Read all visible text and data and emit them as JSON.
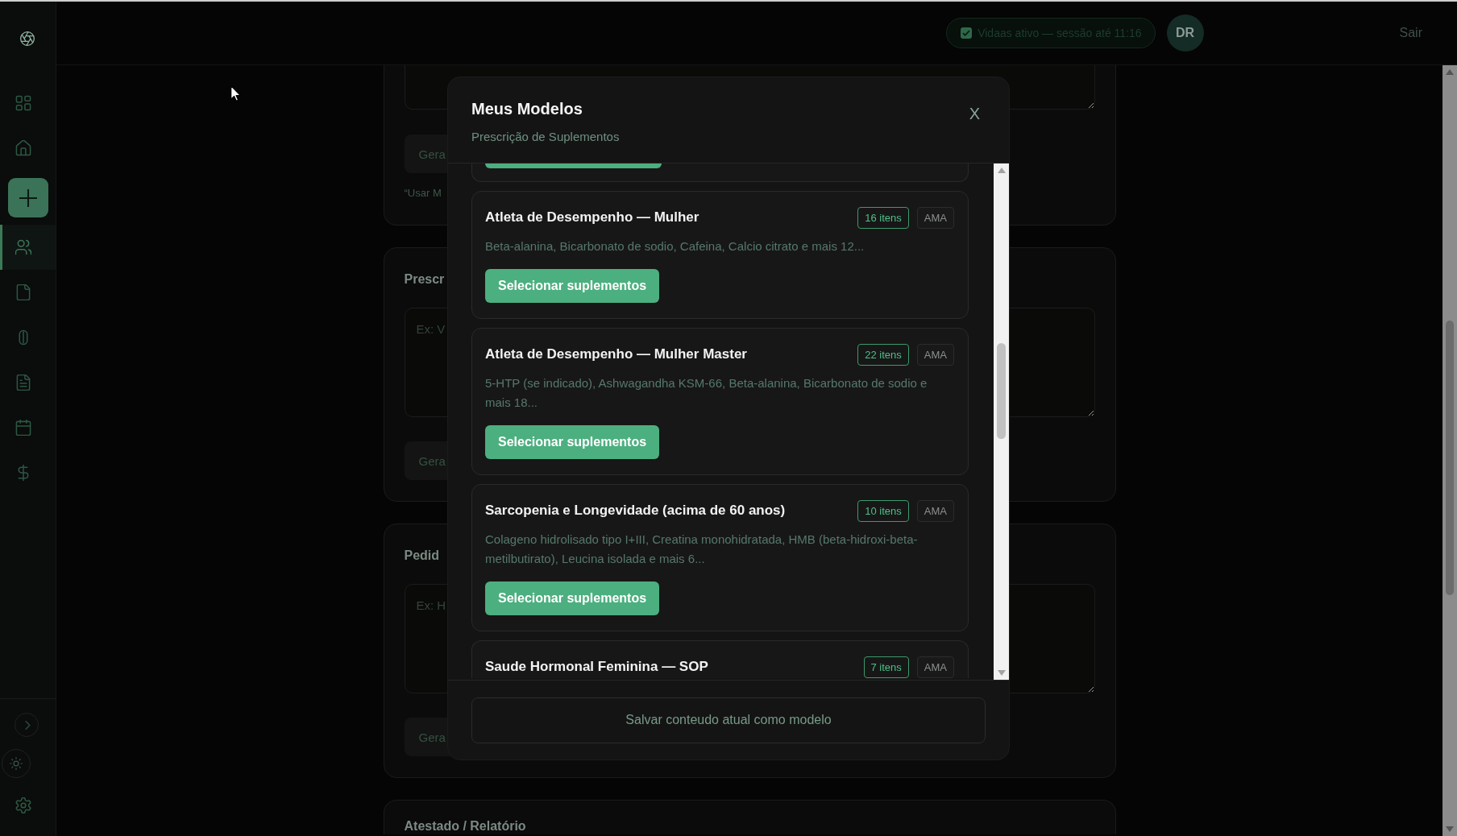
{
  "sidebar": {
    "items": [
      {
        "kind": "dashboard",
        "selected": false
      },
      {
        "kind": "home",
        "selected": false
      },
      {
        "kind": "add",
        "selected": false
      },
      {
        "kind": "patients",
        "selected": true
      },
      {
        "kind": "document",
        "selected": false
      },
      {
        "kind": "capsule",
        "selected": false
      },
      {
        "kind": "report",
        "selected": false
      },
      {
        "kind": "calendar",
        "selected": false
      },
      {
        "kind": "finance",
        "selected": false
      }
    ],
    "bottom_items": [
      {
        "kind": "expand"
      },
      {
        "kind": "theme"
      },
      {
        "kind": "settings"
      }
    ]
  },
  "top_bar": {
    "session_badge": {
      "text": "Vidaas ativo — sessão até 11:16",
      "checked": true
    },
    "avatar": "DR",
    "logout": "Sair"
  },
  "page": {
    "sections": [
      {
        "kind": "continued",
        "button": "Gera",
        "note": "“Usar M"
      },
      {
        "kind": "form",
        "title": "Prescr",
        "placeholder": "Ex: V",
        "button": "Gera"
      },
      {
        "kind": "form",
        "title": "Pedid",
        "placeholder": "Ex: H",
        "button": "Gera"
      },
      {
        "kind": "heading",
        "title": "Atestado / Relatório"
      }
    ]
  },
  "modal": {
    "title": "Meus Modelos",
    "subtitle": "Prescrição de Suplementos",
    "close": "X",
    "list": {
      "card_above_cut": true,
      "templates": [
        {
          "name": "Atleta de Desempenho — Mulher",
          "count": "16 itens",
          "tag": "AMA",
          "description": "Beta-alanina, Bicarbonato de sodio, Cafeina, Calcio citrato e mais 12...",
          "button": "Selecionar suplementos"
        },
        {
          "name": "Atleta de Desempenho — Mulher Master",
          "count": "22 itens",
          "tag": "AMA",
          "description": "5-HTP (se indicado), Ashwagandha KSM-66, Beta-alanina, Bicarbonato de sodio e mais 18...",
          "button": "Selecionar suplementos"
        },
        {
          "name": "Sarcopenia e Longevidade (acima de 60 anos)",
          "count": "10 itens",
          "tag": "AMA",
          "description": "Colageno hidrolisado tipo I+III, Creatina monohidratada, HMB (beta-hidroxi-beta-metilbutirato), Leucina isolada e mais 6...",
          "button": "Selecionar suplementos"
        },
        {
          "name": "Saude Hormonal Feminina — SOP",
          "count": "7 itens",
          "tag": "AMA"
        }
      ]
    },
    "save_button": "Salvar conteudo atual como modelo"
  }
}
